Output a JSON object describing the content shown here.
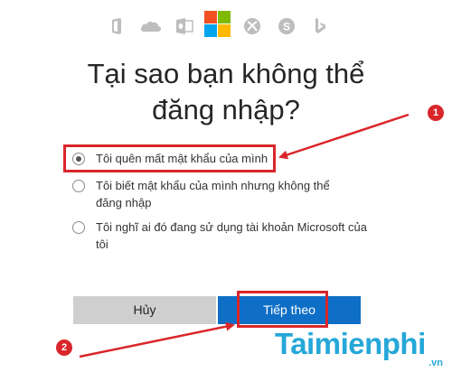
{
  "header": {
    "icons": [
      "office-icon",
      "onedrive-icon",
      "outlook-icon",
      "microsoft-logo",
      "xbox-icon",
      "skype-icon",
      "bing-icon"
    ]
  },
  "title_line1": "Tại sao bạn không thể",
  "title_line2": "đăng nhập?",
  "options": [
    {
      "label": "Tôi quên mất mật khẩu của mình",
      "checked": true
    },
    {
      "label": "Tôi biết mật khẩu của mình nhưng không thể đăng nhập",
      "checked": false
    },
    {
      "label": "Tôi nghĩ ai đó đang sử dụng tài khoản Microsoft của tôi",
      "checked": false
    }
  ],
  "buttons": {
    "cancel": "Hủy",
    "next": "Tiếp theo"
  },
  "annotations": {
    "badge1": "1",
    "badge2": "2",
    "color": "#d9262b"
  },
  "watermark": {
    "text": "Taimienphi",
    "sub": ".vn"
  },
  "colors": {
    "next_button": "#0f6fc6",
    "cancel_button": "#cfcfcf",
    "watermark": "#25a7d8"
  }
}
